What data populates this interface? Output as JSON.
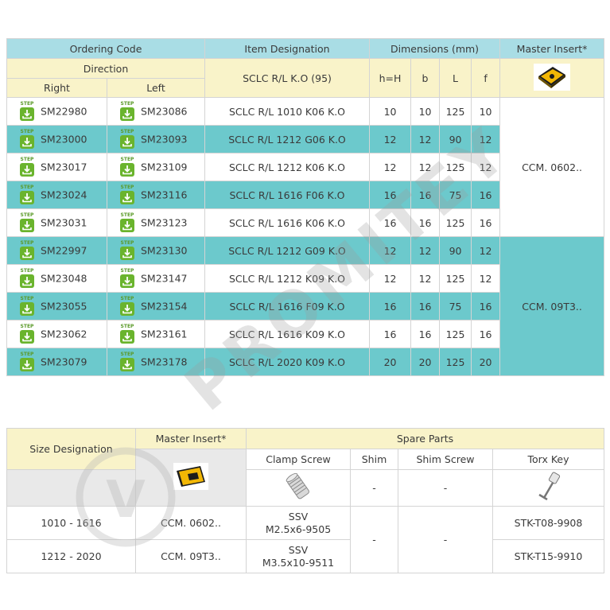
{
  "table1": {
    "headers": {
      "ordering_code": "Ordering Code",
      "item_designation": "Item Designation",
      "dimensions": "Dimensions (mm)",
      "master_insert": "Master Insert*",
      "direction": "Direction",
      "right": "Right",
      "left": "Left",
      "designation_sub": "SCLC R/L K.O (95)",
      "h": "h=H",
      "b": "b",
      "L": "L",
      "f": "f"
    },
    "step_label": "STEP",
    "rows": [
      {
        "right": "SM22980",
        "left": "SM23086",
        "item": "SCLC R/L 1010 K06 K.O",
        "h": "10",
        "b": "10",
        "L": "125",
        "f": "10"
      },
      {
        "right": "SM23000",
        "left": "SM23093",
        "item": "SCLC R/L 1212 G06 K.O",
        "h": "12",
        "b": "12",
        "L": "90",
        "f": "12"
      },
      {
        "right": "SM23017",
        "left": "SM23109",
        "item": "SCLC R/L 1212 K06 K.O",
        "h": "12",
        "b": "12",
        "L": "125",
        "f": "12"
      },
      {
        "right": "SM23024",
        "left": "SM23116",
        "item": "SCLC R/L 1616 F06 K.O",
        "h": "16",
        "b": "16",
        "L": "75",
        "f": "16"
      },
      {
        "right": "SM23031",
        "left": "SM23123",
        "item": "SCLC R/L 1616 K06 K.O",
        "h": "16",
        "b": "16",
        "L": "125",
        "f": "16"
      },
      {
        "right": "SM22997",
        "left": "SM23130",
        "item": "SCLC R/L 1212 G09 K.O",
        "h": "12",
        "b": "12",
        "L": "90",
        "f": "12"
      },
      {
        "right": "SM23048",
        "left": "SM23147",
        "item": "SCLC R/L 1212 K09 K.O",
        "h": "12",
        "b": "12",
        "L": "125",
        "f": "12"
      },
      {
        "right": "SM23055",
        "left": "SM23154",
        "item": "SCLC R/L 1616 F09 K.O",
        "h": "16",
        "b": "16",
        "L": "75",
        "f": "16"
      },
      {
        "right": "SM23062",
        "left": "SM23161",
        "item": "SCLC R/L 1616 K09 K.O",
        "h": "16",
        "b": "16",
        "L": "125",
        "f": "16"
      },
      {
        "right": "SM23079",
        "left": "SM23178",
        "item": "SCLC R/L 2020 K09 K.O",
        "h": "20",
        "b": "20",
        "L": "125",
        "f": "20"
      }
    ],
    "insert_group_1": "CCM. 0602..",
    "insert_group_2": "CCM. 09T3.."
  },
  "table2": {
    "headers": {
      "size_designation": "Size Designation",
      "master_insert": "Master Insert*",
      "spare_parts": "Spare Parts",
      "clamp_screw": "Clamp Screw",
      "shim": "Shim",
      "shim_screw": "Shim Screw",
      "torx_key": "Torx Key"
    },
    "dash": "-",
    "rows": [
      {
        "size": "1010 - 1616",
        "insert": "CCM. 0602..",
        "clamp_line1": "SSV",
        "clamp_line2": "M2.5x6-9505",
        "torx": "STK-T08-9908"
      },
      {
        "size": "1212 - 2020",
        "insert": "CCM. 09T3..",
        "clamp_line1": "SSV",
        "clamp_line2": "M3.5x10-9511",
        "torx": "STK-T15-9910"
      }
    ],
    "shim_value": "-",
    "shim_screw_value": "-"
  },
  "watermark": "PROMITEY",
  "colors": {
    "header_teal": "#a9dde5",
    "header_yellow": "#f9f3c9",
    "row_teal": "#6cc9cc",
    "step_green": "#6ab42d"
  }
}
